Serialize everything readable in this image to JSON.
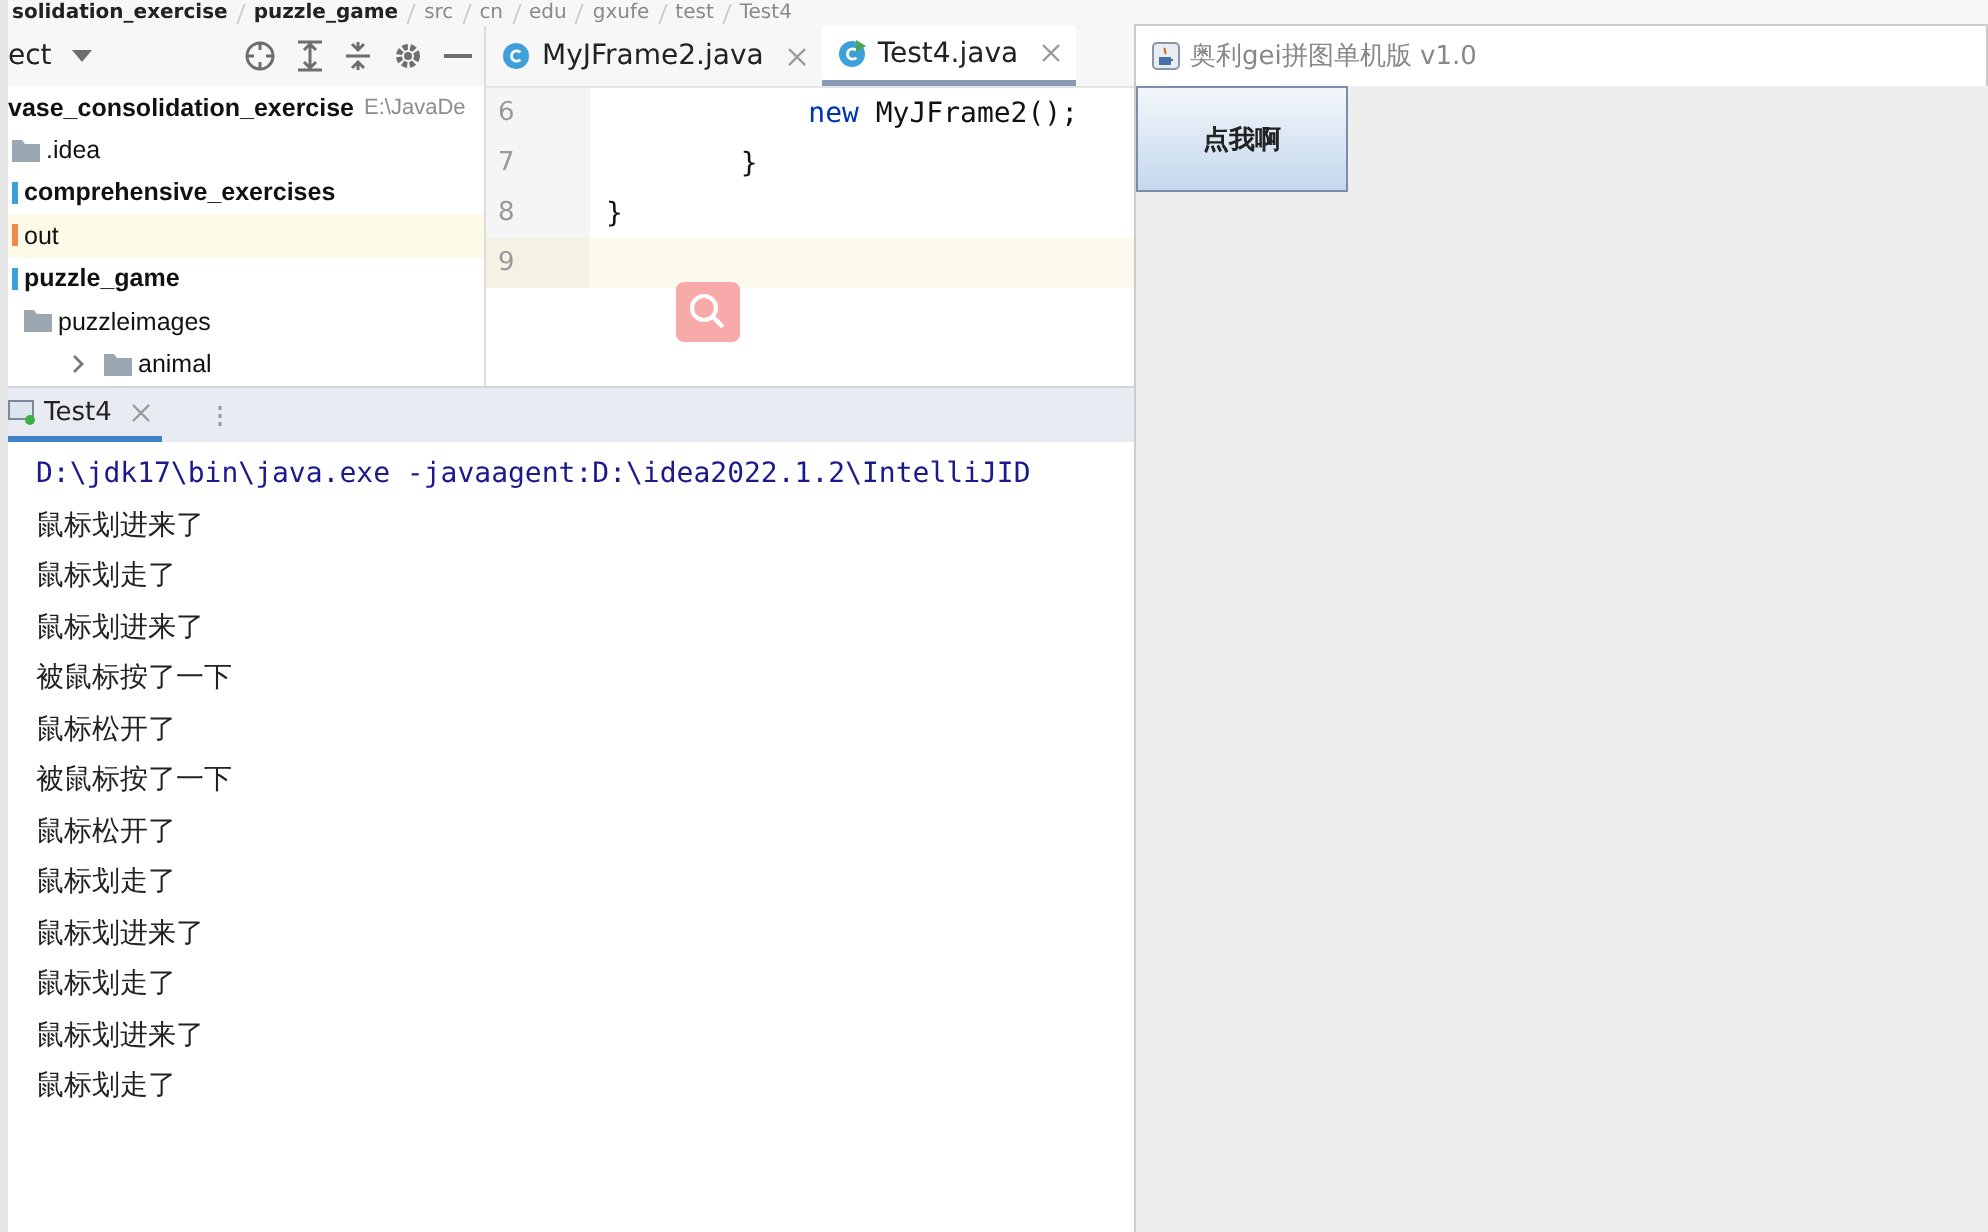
{
  "breadcrumb": [
    "solidation_exercise",
    "puzzle_game",
    "src",
    "cn",
    "edu",
    "gxufe",
    "test",
    "Test4"
  ],
  "project_panel": {
    "title": "ect",
    "tree": [
      {
        "label": "vase_consolidation_exercise",
        "path": "E:\\JavaDe",
        "bold": true,
        "selected": false,
        "children": [
          {
            "label": ".idea",
            "bold": false,
            "selected": false,
            "kind": "folder"
          },
          {
            "label": "comprehensive_exercises",
            "bold": true,
            "selected": false,
            "kind": "module"
          },
          {
            "label": "out",
            "bold": false,
            "selected": true,
            "kind": "excluded"
          },
          {
            "label": "puzzle_game",
            "bold": true,
            "selected": false,
            "kind": "module",
            "children": [
              {
                "label": "puzzleimages",
                "bold": false,
                "selected": false,
                "kind": "folder",
                "expanded": true,
                "children": [
                  {
                    "label": "animal",
                    "bold": false,
                    "selected": false,
                    "kind": "folder",
                    "expanded": false
                  }
                ]
              }
            ]
          }
        ]
      }
    ]
  },
  "editor": {
    "tabs": [
      {
        "label": "MyJFrame2.java",
        "selected": false,
        "kind": "class"
      },
      {
        "label": "Test4.java",
        "selected": true,
        "kind": "runnable"
      }
    ],
    "lines": [
      {
        "number": "6",
        "code": "            new MyJFrame2();",
        "kind": "keyword",
        "current": false
      },
      {
        "number": "7",
        "code": "        }",
        "kind": "plain",
        "current": false
      },
      {
        "number": "8",
        "code": "}",
        "kind": "plain",
        "current": false
      },
      {
        "number": "9",
        "current": true
      }
    ]
  },
  "run_panel": {
    "tabs": [
      {
        "label": "Test4",
        "selected": true
      }
    ],
    "console": [
      {
        "text": "D:\\jdk17\\bin\\java.exe -javaagent:D:\\idea2022.1.2\\IntelliJID",
        "kind": "command"
      },
      {
        "text": "鼠标划进来了",
        "kind": "output"
      },
      {
        "text": "鼠标划走了",
        "kind": "output"
      },
      {
        "text": "鼠标划进来了",
        "kind": "output"
      },
      {
        "text": "被鼠标按了一下",
        "kind": "output"
      },
      {
        "text": "鼠标松开了",
        "kind": "output"
      },
      {
        "text": "被鼠标按了一下",
        "kind": "output"
      },
      {
        "text": "鼠标松开了",
        "kind": "output"
      },
      {
        "text": "鼠标划走了",
        "kind": "output"
      },
      {
        "text": "鼠标划进来了",
        "kind": "output"
      },
      {
        "text": "鼠标划走了",
        "kind": "output"
      },
      {
        "text": "鼠标划进来了",
        "kind": "output"
      },
      {
        "text": "鼠标划走了",
        "kind": "output"
      }
    ]
  },
  "app_window": {
    "title": "奥利gei拼图单机版 v1.0",
    "button": "点我啊"
  }
}
